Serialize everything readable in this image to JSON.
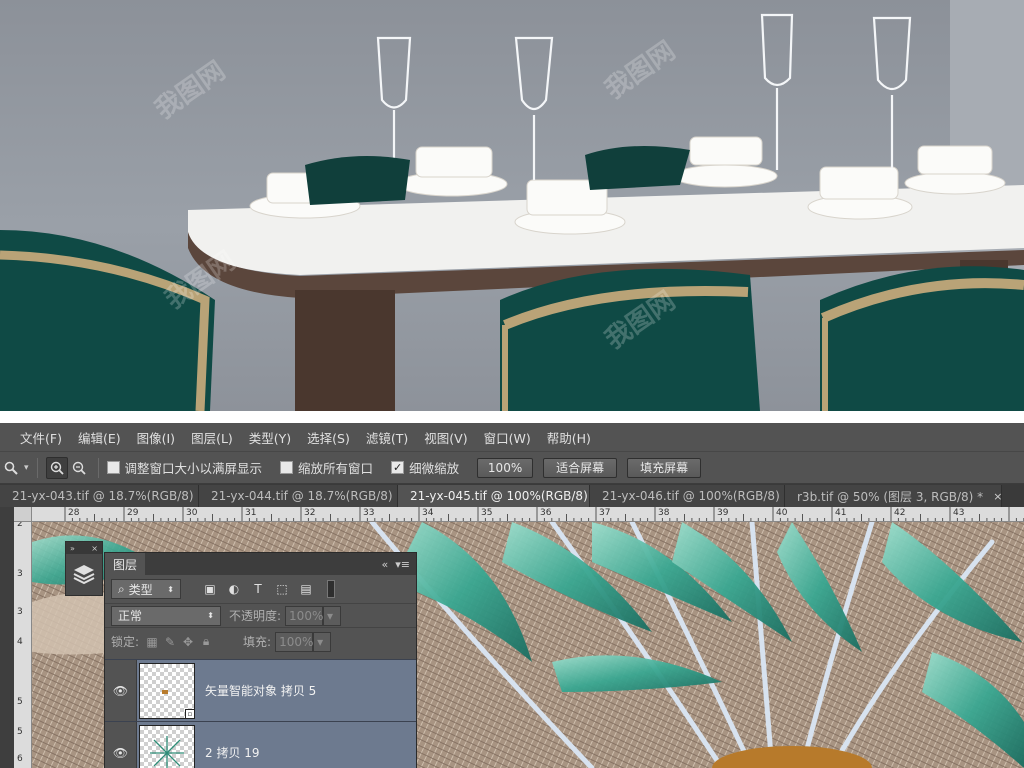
{
  "menu": [
    "文件(F)",
    "编辑(E)",
    "图像(I)",
    "图层(L)",
    "类型(Y)",
    "选择(S)",
    "滤镜(T)",
    "视图(V)",
    "窗口(W)",
    "帮助(H)"
  ],
  "options": {
    "resize_windows": "调整窗口大小以满屏显示",
    "zoom_all": "缩放所有窗口",
    "scrubby_zoom": "细微缩放",
    "zoom_100": "100%",
    "fit_screen": "适合屏幕",
    "fill_screen": "填充屏幕"
  },
  "tabs": [
    {
      "label": "21-yx-043.tif @ 18.7%(RGB/8)",
      "active": false
    },
    {
      "label": "21-yx-044.tif @ 18.7%(RGB/8)",
      "active": false
    },
    {
      "label": "21-yx-045.tif @ 100%(RGB/8)",
      "active": true
    },
    {
      "label": "21-yx-046.tif @ 100%(RGB/8)",
      "active": false
    },
    {
      "label": "r3b.tif @ 50% (图层 3, RGB/8) *",
      "active": false
    }
  ],
  "tab_close": "×",
  "ruler_h": [
    "28",
    "29",
    "30",
    "31",
    "32",
    "33",
    "34",
    "35",
    "36",
    "37",
    "38",
    "39",
    "40",
    "41",
    "42",
    "43"
  ],
  "ruler_v": [
    "2",
    "3",
    "3",
    "4",
    "5",
    "5",
    "6"
  ],
  "layers": {
    "title": "图层",
    "filter_kind": "类型",
    "blend_mode": "正常",
    "opacity_label": "不透明度:",
    "opacity_value": "100%",
    "lock_label": "锁定:",
    "fill_label": "填充:",
    "fill_value": "100%",
    "items": [
      {
        "name": "矢量智能对象 拷贝 5"
      },
      {
        "name": "2 拷贝 19"
      }
    ]
  },
  "colors": {
    "app_bg": "#535353",
    "selected_layer": "#6d7a8f",
    "chair_teal": "#0f4a45",
    "leaf_teal": "#3aa892"
  },
  "watermark": "我图网"
}
